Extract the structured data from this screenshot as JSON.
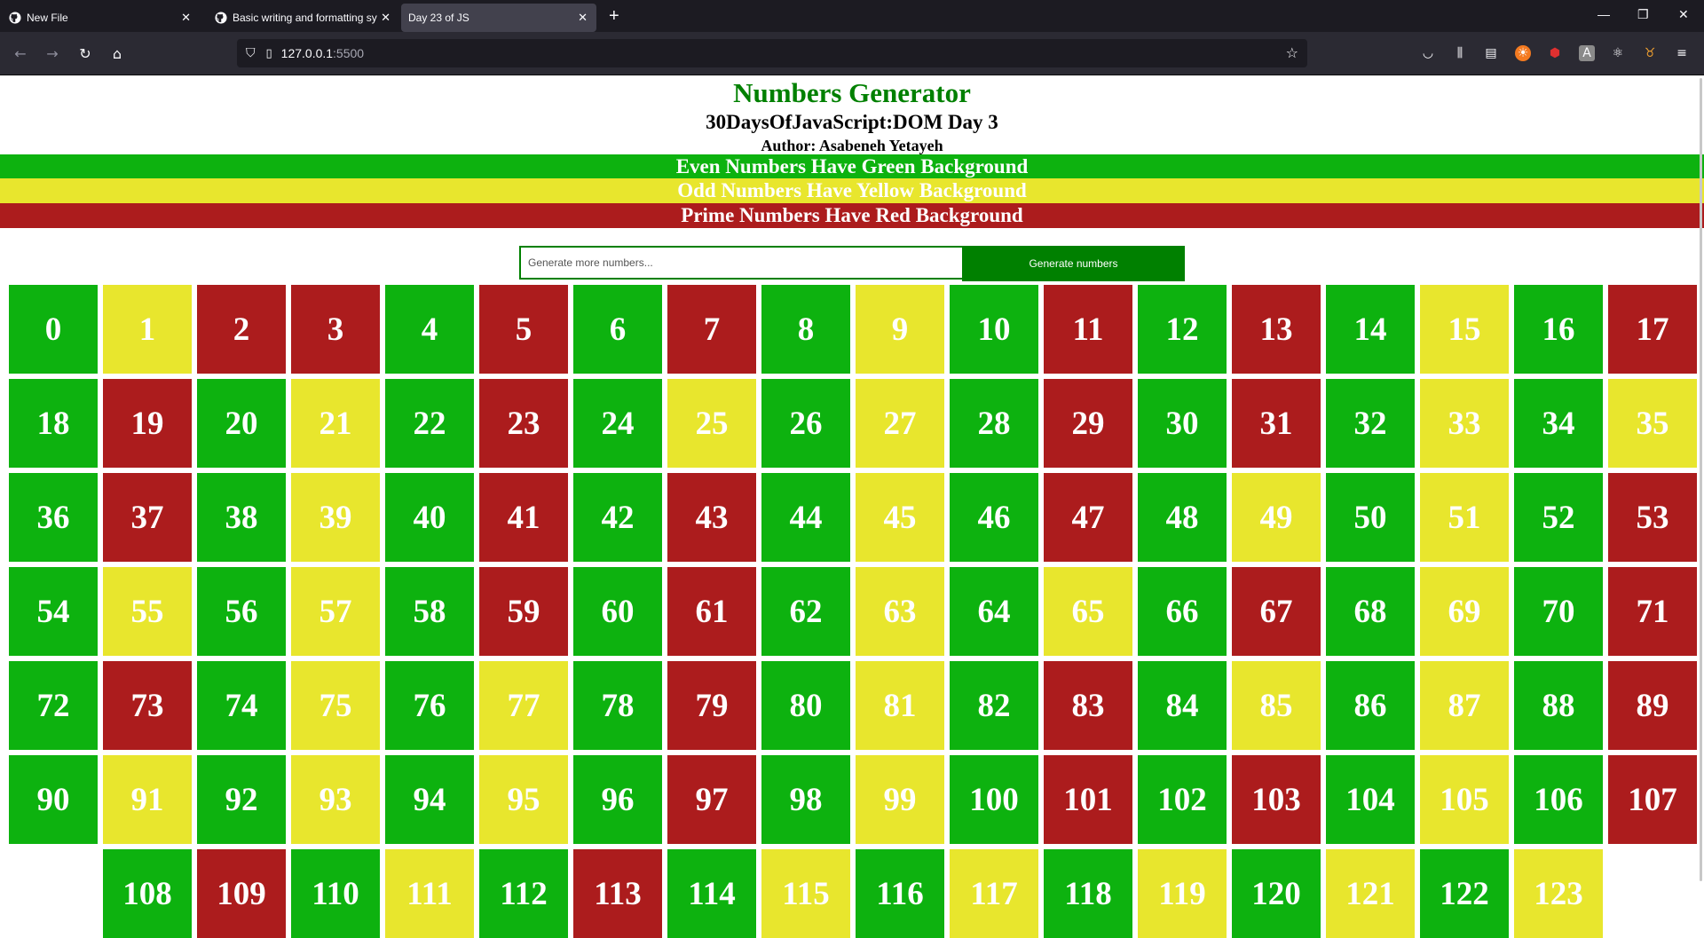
{
  "browser": {
    "tabs": [
      {
        "label": "New File",
        "icon": "github-icon",
        "active": false
      },
      {
        "label": "Basic writing and formatting sy",
        "icon": "github-icon",
        "active": false
      },
      {
        "label": "Day 23 of JS",
        "icon": "",
        "active": true
      }
    ],
    "url_host": "127.0.0.1",
    "url_port": ":5500"
  },
  "page": {
    "title": "Numbers Generator",
    "subtitle": "30DaysOfJavaScript:DOM Day 3",
    "author": "Author: Asabeneh Yetayeh",
    "legend": {
      "even": "Even Numbers Have Green Background",
      "odd": "Odd Numbers Have Yellow Background",
      "prime": "Prime Numbers Have Red Background"
    },
    "input_placeholder": "Generate more numbers...",
    "button_label": "Generate numbers",
    "colors": {
      "even": "#0db20f",
      "odd": "#e8e62d",
      "prime": "#ac1c1d",
      "accent": "#008000"
    },
    "numbers": [
      0,
      1,
      2,
      3,
      4,
      5,
      6,
      7,
      8,
      9,
      10,
      11,
      12,
      13,
      14,
      15,
      16,
      17,
      18,
      19,
      20,
      21,
      22,
      23,
      24,
      25,
      26,
      27,
      28,
      29,
      30,
      31,
      32,
      33,
      34,
      35,
      36,
      37,
      38,
      39,
      40,
      41,
      42,
      43,
      44,
      45,
      46,
      47,
      48,
      49,
      50,
      51,
      52,
      53,
      54,
      55,
      56,
      57,
      58,
      59,
      60,
      61,
      62,
      63,
      64,
      65,
      66,
      67,
      68,
      69,
      70,
      71,
      72,
      73,
      74,
      75,
      76,
      77,
      78,
      79,
      80,
      81,
      82,
      83,
      84,
      85,
      86,
      87,
      88,
      89,
      90,
      91,
      92,
      93,
      94,
      95,
      96,
      97,
      98,
      99,
      100,
      101,
      102,
      103,
      104,
      105,
      106,
      107,
      108,
      109,
      110,
      111,
      112,
      113,
      114,
      115,
      116,
      117,
      118,
      119,
      120,
      121,
      122,
      123
    ]
  }
}
